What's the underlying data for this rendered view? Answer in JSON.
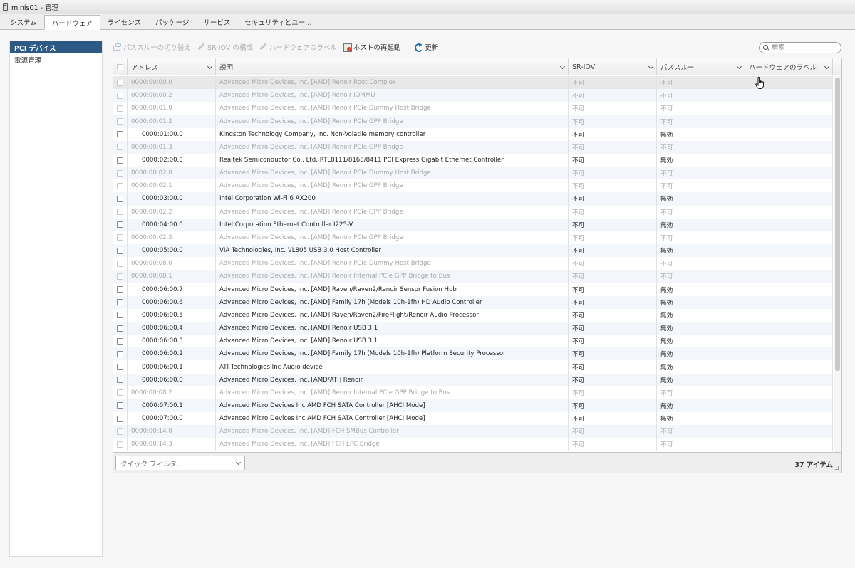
{
  "window": {
    "title": "minis01 - 管理"
  },
  "tabs": [
    {
      "label": "システム"
    },
    {
      "label": "ハードウェア",
      "active": true
    },
    {
      "label": "ライセンス"
    },
    {
      "label": "パッケージ"
    },
    {
      "label": "サービス"
    },
    {
      "label": "セキュリティとユー..."
    }
  ],
  "sidebar": {
    "items": [
      {
        "label": "PCI デバイス",
        "selected": true
      },
      {
        "label": "電源管理"
      }
    ]
  },
  "toolbar": {
    "toggle_passthrough": "パススルーの切り替え",
    "configure_sriov": "SR-IOV の構成",
    "hardware_label": "ハードウェアのラベル",
    "reboot_host": "ホストの再起動",
    "refresh": "更新"
  },
  "search": {
    "placeholder": "検索",
    "value": ""
  },
  "table": {
    "columns": {
      "address": "アドレス",
      "description": "説明",
      "sriov": "SR-IOV",
      "passthrough": "パススルー",
      "hardware_label": "ハードウェアのラベル"
    },
    "rows": [
      {
        "address": "0000:00:00.0",
        "description": "Advanced Micro Devices, Inc. [AMD] Renoir Root Complex",
        "sriov": "不可",
        "passthrough": "不可",
        "enabled": false
      },
      {
        "address": "0000:00:00.2",
        "description": "Advanced Micro Devices, Inc. [AMD] Renoir IOMMU",
        "sriov": "不可",
        "passthrough": "不可",
        "enabled": false
      },
      {
        "address": "0000:00:01.0",
        "description": "Advanced Micro Devices, Inc. [AMD] Renoir PCIe Dummy Host Bridge",
        "sriov": "不可",
        "passthrough": "不可",
        "enabled": false
      },
      {
        "address": "0000:00:01.2",
        "description": "Advanced Micro Devices, Inc. [AMD] Renoir PCIe GPP Bridge",
        "sriov": "不可",
        "passthrough": "不可",
        "enabled": false
      },
      {
        "address": "0000:01:00.0",
        "description": "Kingston Technology Company, Inc. Non-Volatile memory controller",
        "sriov": "不可",
        "passthrough": "無効",
        "enabled": true
      },
      {
        "address": "0000:00:01.3",
        "description": "Advanced Micro Devices, Inc. [AMD] Renoir PCIe GPP Bridge",
        "sriov": "不可",
        "passthrough": "不可",
        "enabled": false
      },
      {
        "address": "0000:02:00.0",
        "description": "Realtek Semiconductor Co., Ltd. RTL8111/8168/8411 PCI Express Gigabit Ethernet Controller",
        "sriov": "不可",
        "passthrough": "無効",
        "enabled": true
      },
      {
        "address": "0000:00:02.0",
        "description": "Advanced Micro Devices, Inc. [AMD] Renoir PCIe Dummy Host Bridge",
        "sriov": "不可",
        "passthrough": "不可",
        "enabled": false
      },
      {
        "address": "0000:00:02.1",
        "description": "Advanced Micro Devices, Inc. [AMD] Renoir PCIe GPP Bridge",
        "sriov": "不可",
        "passthrough": "不可",
        "enabled": false
      },
      {
        "address": "0000:03:00.0",
        "description": "Intel Corporation Wi-Fi 6 AX200",
        "sriov": "不可",
        "passthrough": "無効",
        "enabled": true
      },
      {
        "address": "0000:00:02.2",
        "description": "Advanced Micro Devices, Inc. [AMD] Renoir PCIe GPP Bridge",
        "sriov": "不可",
        "passthrough": "不可",
        "enabled": false
      },
      {
        "address": "0000:04:00.0",
        "description": "Intel Corporation Ethernet Controller I225-V",
        "sriov": "不可",
        "passthrough": "無効",
        "enabled": true
      },
      {
        "address": "0000:00:02.3",
        "description": "Advanced Micro Devices, Inc. [AMD] Renoir PCIe GPP Bridge",
        "sriov": "不可",
        "passthrough": "不可",
        "enabled": false
      },
      {
        "address": "0000:05:00.0",
        "description": "VIA Technologies, Inc. VL805 USB 3.0 Host Controller",
        "sriov": "不可",
        "passthrough": "無効",
        "enabled": true
      },
      {
        "address": "0000:00:08.0",
        "description": "Advanced Micro Devices, Inc. [AMD] Renoir PCIe Dummy Host Bridge",
        "sriov": "不可",
        "passthrough": "不可",
        "enabled": false
      },
      {
        "address": "0000:00:08.1",
        "description": "Advanced Micro Devices, Inc. [AMD] Renoir Internal PCIe GPP Bridge to Bus",
        "sriov": "不可",
        "passthrough": "不可",
        "enabled": false
      },
      {
        "address": "0000:06:00.7",
        "description": "Advanced Micro Devices, Inc. [AMD] Raven/Raven2/Renoir Sensor Fusion Hub",
        "sriov": "不可",
        "passthrough": "無効",
        "enabled": true
      },
      {
        "address": "0000:06:00.6",
        "description": "Advanced Micro Devices, Inc. [AMD] Family 17h (Models 10h-1fh) HD Audio Controller",
        "sriov": "不可",
        "passthrough": "無効",
        "enabled": true
      },
      {
        "address": "0000:06:00.5",
        "description": "Advanced Micro Devices, Inc. [AMD] Raven/Raven2/FireFlight/Renoir Audio Processor",
        "sriov": "不可",
        "passthrough": "無効",
        "enabled": true
      },
      {
        "address": "0000:06:00.4",
        "description": "Advanced Micro Devices, Inc. [AMD] Renoir USB 3.1",
        "sriov": "不可",
        "passthrough": "無効",
        "enabled": true
      },
      {
        "address": "0000:06:00.3",
        "description": "Advanced Micro Devices, Inc. [AMD] Renoir USB 3.1",
        "sriov": "不可",
        "passthrough": "無効",
        "enabled": true
      },
      {
        "address": "0000:06:00.2",
        "description": "Advanced Micro Devices, Inc. [AMD] Family 17h (Models 10h-1fh) Platform Security Processor",
        "sriov": "不可",
        "passthrough": "無効",
        "enabled": true
      },
      {
        "address": "0000:06:00.1",
        "description": "ATI Technologies Inc Audio device",
        "sriov": "不可",
        "passthrough": "無効",
        "enabled": true
      },
      {
        "address": "0000:06:00.0",
        "description": "Advanced Micro Devices, Inc. [AMD/ATI] Renoir",
        "sriov": "不可",
        "passthrough": "無効",
        "enabled": true
      },
      {
        "address": "0000:00:08.2",
        "description": "Advanced Micro Devices, Inc. [AMD] Renoir Internal PCIe GPP Bridge to Bus",
        "sriov": "不可",
        "passthrough": "不可",
        "enabled": false
      },
      {
        "address": "0000:07:00.1",
        "description": "Advanced Micro Devices Inc AMD FCH SATA Controller [AHCI Mode]",
        "sriov": "不可",
        "passthrough": "無効",
        "enabled": true
      },
      {
        "address": "0000:07:00.0",
        "description": "Advanced Micro Devices Inc AMD FCH SATA Controller [AHCI Mode]",
        "sriov": "不可",
        "passthrough": "無効",
        "enabled": true
      },
      {
        "address": "0000:00:14.0",
        "description": "Advanced Micro Devices, Inc. [AMD] FCH SMBus Controller",
        "sriov": "不可",
        "passthrough": "不可",
        "enabled": false
      },
      {
        "address": "0000:00:14.3",
        "description": "Advanced Micro Devices, Inc. [AMD] FCH LPC Bridge",
        "sriov": "不可",
        "passthrough": "不可",
        "enabled": false
      }
    ]
  },
  "footer": {
    "quick_filter_placeholder": "クイック フィルタ...",
    "item_count": "37 アイテム"
  }
}
